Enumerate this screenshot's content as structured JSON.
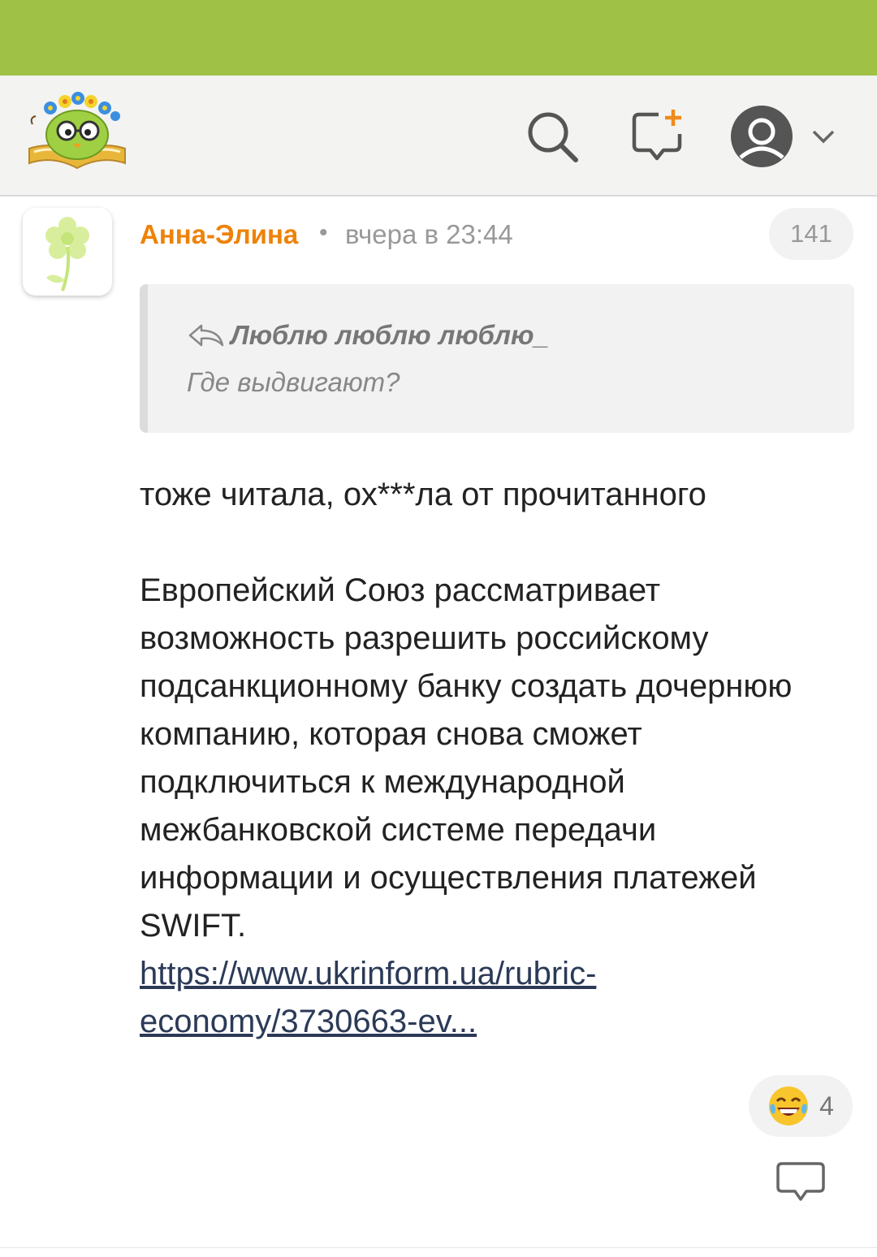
{
  "colors": {
    "status_bar": "#9ec146",
    "top_bar": "#f3f3f1",
    "author_name": "#ee8208",
    "meta_text": "#999999",
    "link": "#2b3a57"
  },
  "header": {
    "logo_icon": "owl-reading-book-logo",
    "search_icon": "search-icon",
    "new_post_icon": "new-message-icon",
    "profile_icon": "user-avatar-icon",
    "dropdown_icon": "chevron-down-icon"
  },
  "post": {
    "author": "Анна-Элина",
    "separator": "•",
    "timestamp": "вчера в 23:44",
    "counter": "141",
    "quote": {
      "icon": "reply-arrow-icon",
      "title": "Люблю люблю люблю_",
      "text": "Где выдвигают?"
    },
    "text_line_1": "тоже читала, ох***ла от прочитанного",
    "text_paragraph": "Европейский Союз рассматривает возможность разрешить российскому подсанкционному банку создать дочернюю компанию, которая снова сможет подключиться к международной межбанковской системе передачи информации и осуществления платежей SWIFT.",
    "link_line_1": "https://www.ukrinform.ua/rubric-",
    "link_line_2": "economy/3730663-ev...",
    "reaction": {
      "emoji": "😂",
      "count": "4"
    },
    "comment_icon": "comment-bubble-icon"
  }
}
